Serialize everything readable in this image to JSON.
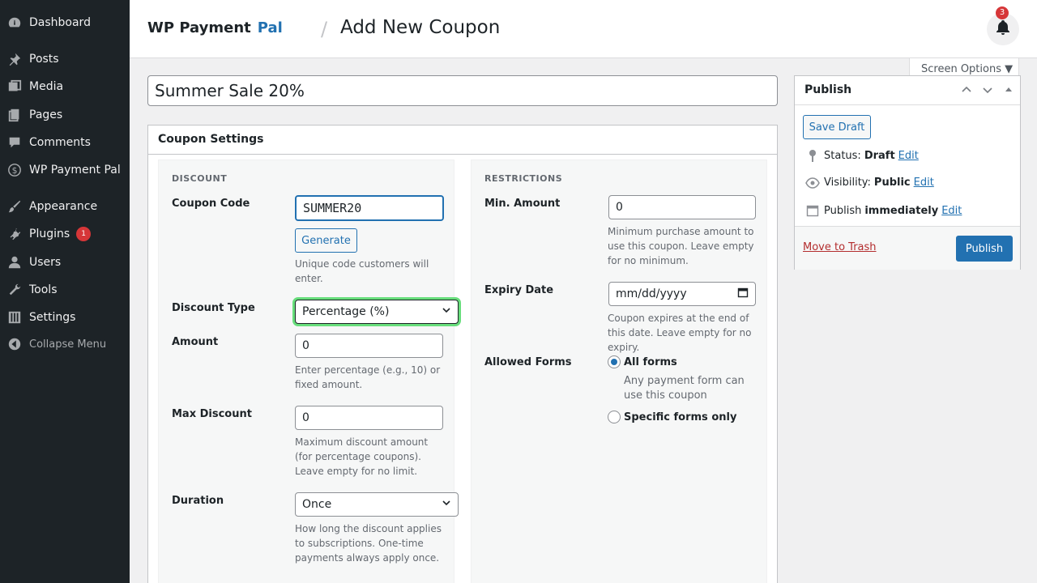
{
  "sidebar": {
    "items": [
      {
        "label": "Dashboard",
        "icon": "dashboard-icon"
      },
      {
        "label": "Posts",
        "icon": "pin-icon"
      },
      {
        "label": "Media",
        "icon": "media-icon"
      },
      {
        "label": "Pages",
        "icon": "pages-icon"
      },
      {
        "label": "Comments",
        "icon": "comment-icon"
      },
      {
        "label": "WP Payment Pal",
        "icon": "dollar-icon"
      },
      {
        "label": "Appearance",
        "icon": "brush-icon"
      },
      {
        "label": "Plugins",
        "icon": "plugin-icon",
        "badge": "1"
      },
      {
        "label": "Users",
        "icon": "user-icon"
      },
      {
        "label": "Tools",
        "icon": "wrench-icon"
      },
      {
        "label": "Settings",
        "icon": "settings-icon"
      }
    ],
    "collapse_label": "Collapse Menu"
  },
  "header": {
    "brand_main": "WP Payment",
    "brand_accent": "Pal",
    "separator": "/",
    "page_title": "Add New Coupon",
    "notification_count": "3"
  },
  "screen_options": "Screen Options ▼",
  "post_title": "Summer Sale 20%",
  "coupon_settings": {
    "heading": "Coupon Settings",
    "discount": {
      "section_title": "DISCOUNT",
      "coupon_code_label": "Coupon Code",
      "coupon_code_value": "SUMMER20",
      "generate_label": "Generate",
      "coupon_code_help": "Unique code customers will enter.",
      "discount_type_label": "Discount Type",
      "discount_type_value": "Percentage (%)",
      "amount_label": "Amount",
      "amount_value": "0",
      "amount_help": "Enter percentage (e.g., 10) or fixed amount.",
      "max_discount_label": "Max Discount",
      "max_discount_value": "0",
      "max_discount_help": "Maximum discount amount (for percentage coupons). Leave empty for no limit.",
      "duration_label": "Duration",
      "duration_value": "Once",
      "duration_help": "How long the discount applies to subscriptions. One-time payments always apply once."
    },
    "restrictions": {
      "section_title": "RESTRICTIONS",
      "min_amount_label": "Min. Amount",
      "min_amount_value": "0",
      "min_amount_help": "Minimum purchase amount to use this coupon. Leave empty for no minimum.",
      "expiry_label": "Expiry Date",
      "expiry_placeholder": "mm/dd/yyyy",
      "expiry_help": "Coupon expires at the end of this date. Leave empty for no expiry.",
      "allowed_forms_label": "Allowed Forms",
      "all_forms_label": "All forms",
      "all_forms_help": "Any payment form can use this coupon",
      "specific_forms_label": "Specific forms only"
    }
  },
  "publish": {
    "heading": "Publish",
    "save_draft": "Save Draft",
    "status_label": "Status:",
    "status_value": "Draft",
    "visibility_label": "Visibility:",
    "visibility_value": "Public",
    "publish_label": "Publish",
    "publish_value": "immediately",
    "edit_label": "Edit",
    "move_to_trash": "Move to Trash",
    "publish_button": "Publish"
  }
}
